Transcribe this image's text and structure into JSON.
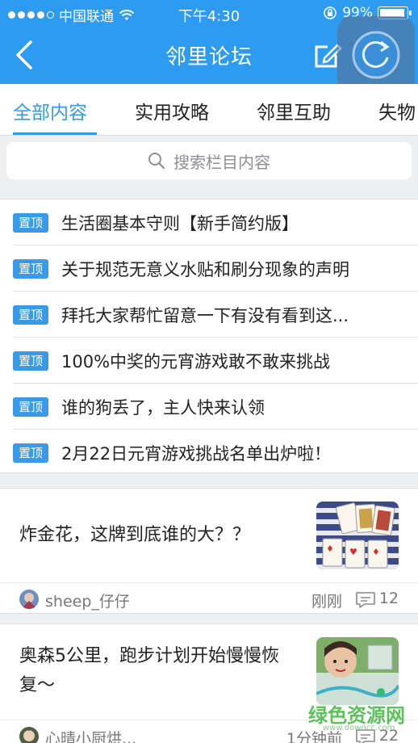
{
  "status_bar": {
    "carrier": "中国联通",
    "time": "下午4:30",
    "battery": "99%"
  },
  "nav": {
    "title": "邻里论坛"
  },
  "tabs": [
    {
      "label": "全部内容",
      "active": true
    },
    {
      "label": "实用攻略",
      "active": false
    },
    {
      "label": "邻里互助",
      "active": false
    },
    {
      "label": "失物",
      "active": false
    }
  ],
  "search": {
    "placeholder": "搜索栏目内容"
  },
  "pinned": {
    "badge": "置顶",
    "items": [
      "生活圈基本守则【新手简约版】",
      "关于规范无意义水贴和刷分现象的声明",
      "拜托大家帮忙留意一下有没有看到这...",
      "100%中奖的元宵游戏敢不敢来挑战",
      "谁的狗丢了，主人快来认领",
      "2月22日元宵游戏挑战名单出炉啦！"
    ]
  },
  "posts": [
    {
      "title": "炸金花，这牌到底谁的大？？",
      "author": "sheep_仔仔",
      "time": "刚刚",
      "comments": "12"
    },
    {
      "title": "奥森5公里，跑步计划开始慢慢恢复～",
      "author": "心晴小厨烘...",
      "time": "1分钟前",
      "comments": "22"
    }
  ],
  "watermark": {
    "text": "绿色资源网",
    "sub": "www.downcc.com"
  },
  "colors": {
    "accent": "#2d9bf0",
    "badge": "#3a9ae8",
    "background": "#eeeff1"
  }
}
